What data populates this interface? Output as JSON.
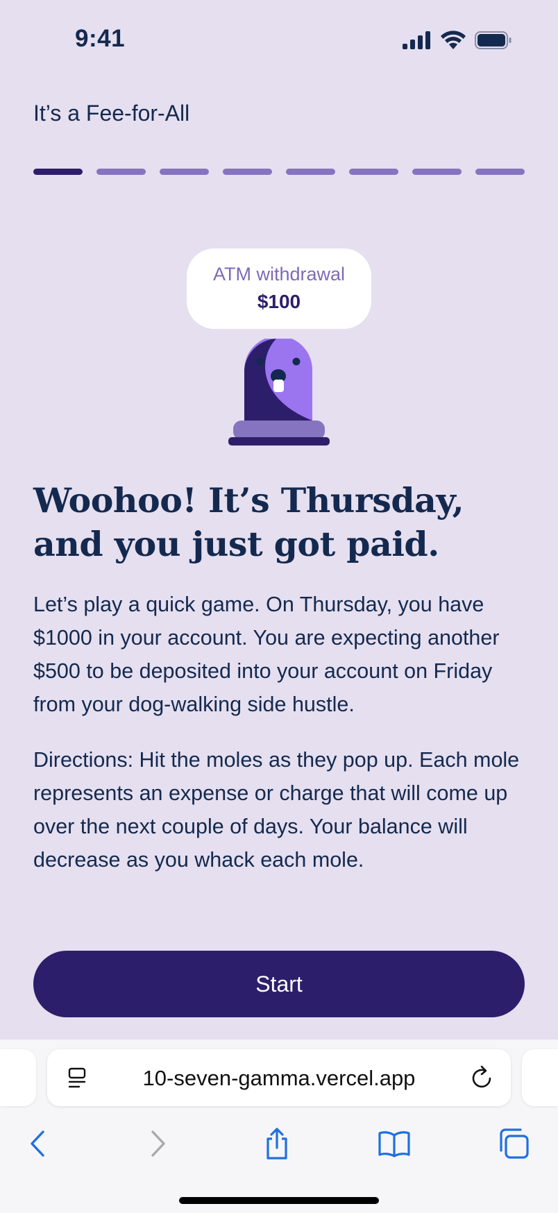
{
  "status_bar": {
    "time": "9:41"
  },
  "app": {
    "title": "It’s a Fee-for-All"
  },
  "progress": {
    "total_steps": 8,
    "current_step": 1
  },
  "fee_card": {
    "label": "ATM withdrawal",
    "amount": "$100"
  },
  "mole": {
    "icon": "mole-icon"
  },
  "content": {
    "headline": "Woohoo! It’s Thursday, and you just got paid.",
    "paragraph_1": "Let’s play a quick game. On Thursday, you have $1000 in your account. You are expecting another $500 to be deposited into your account on Friday from your dog-walking side hustle.",
    "paragraph_2": "Directions: Hit the moles as they pop up. Each mole represents an expense or charge that will come up over the next couple of days. Your balance will decrease as you whack each mole."
  },
  "start_button": {
    "label": "Start"
  },
  "browser": {
    "url": "10-seven-gamma.vercel.app",
    "toolbar": [
      "back-icon",
      "forward-icon",
      "share-icon",
      "bookmarks-icon",
      "tabs-icon"
    ]
  },
  "colors": {
    "background": "#e5dfef",
    "primary": "#2d1e6b",
    "accent": "#8674c0",
    "mole": "#9b75f0",
    "text": "#14294f",
    "link_blue": "#1f6fe0"
  }
}
